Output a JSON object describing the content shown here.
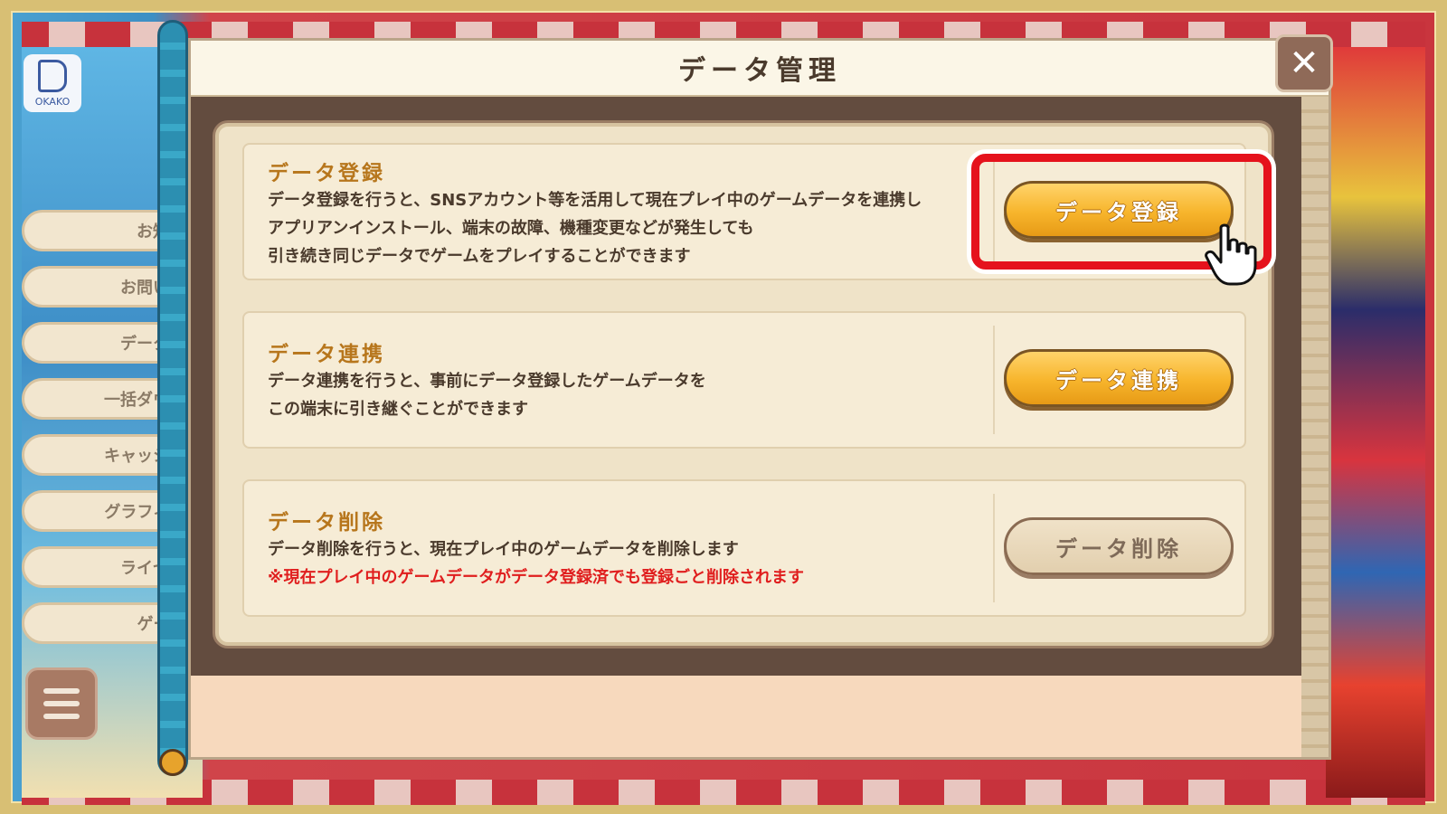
{
  "dialog": {
    "title": "データ管理",
    "close_label": "✕"
  },
  "sections": [
    {
      "title": "データ登録",
      "description": [
        "データ登録を行うと、SNSアカウント等を活用して現在プレイ中のゲームデータを連携し",
        "アプリアンインストール、端末の故障、機種変更などが発生しても",
        "引き続き同じデータでゲームをプレイすることができます"
      ],
      "button_label": "データ登録"
    },
    {
      "title": "データ連携",
      "description": [
        "データ連携を行うと、事前にデータ登録したゲームデータを",
        "この端末に引き継ぐことができます"
      ],
      "button_label": "データ連携"
    },
    {
      "title": "データ削除",
      "description": [
        "データ削除を行うと、現在プレイ中のゲームデータを削除します"
      ],
      "warning": "※現在プレイ中のゲームデータがデータ登録済でも登録ごと削除されます",
      "button_label": "データ削除"
    }
  ],
  "side_menu": {
    "items": [
      "お知ら",
      "お問い合",
      "データ管",
      "一括ダウン",
      "キャッシュ",
      "グラフィッ",
      "ライセン",
      "ゲーム"
    ],
    "logo_text": "OKAKO"
  },
  "icons": {
    "close": "close-icon",
    "menu": "hamburger-menu-icon",
    "pointer": "pointer-hand-icon"
  },
  "colors": {
    "highlight": "#e5121c",
    "section_title": "#b7761c",
    "warning": "#e01e1e",
    "button_gold": "#f7b52c"
  }
}
